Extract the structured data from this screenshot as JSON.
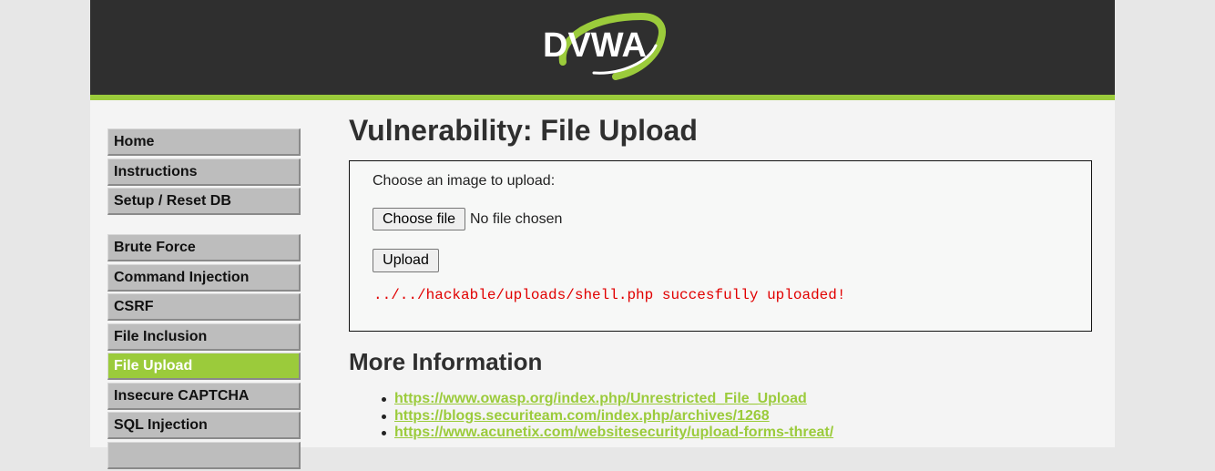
{
  "header": {
    "logo_text": "DVWA"
  },
  "menu": {
    "groups": [
      [
        {
          "label": "Home",
          "selected": false
        },
        {
          "label": "Instructions",
          "selected": false
        },
        {
          "label": "Setup / Reset DB",
          "selected": false
        }
      ],
      [
        {
          "label": "Brute Force",
          "selected": false
        },
        {
          "label": "Command Injection",
          "selected": false
        },
        {
          "label": "CSRF",
          "selected": false
        },
        {
          "label": "File Inclusion",
          "selected": false
        },
        {
          "label": "File Upload",
          "selected": true
        },
        {
          "label": "Insecure CAPTCHA",
          "selected": false
        },
        {
          "label": "SQL Injection",
          "selected": false
        }
      ]
    ]
  },
  "main": {
    "title": "Vulnerability: File Upload",
    "upload_form": {
      "prompt": "Choose an image to upload:",
      "choose_button": "Choose file",
      "file_status": "No file chosen",
      "upload_button": "Upload",
      "result_message": "../../hackable/uploads/shell.php succesfully uploaded!"
    },
    "more_info": {
      "heading": "More Information",
      "links": [
        "https://www.owasp.org/index.php/Unrestricted_File_Upload",
        "https://blogs.securiteam.com/index.php/archives/1268",
        "https://www.acunetix.com/websitesecurity/upload-forms-threat/"
      ]
    }
  },
  "colors": {
    "accent": "#9bcb3b",
    "header_bg": "#2f2f2f",
    "error_text": "#e10000",
    "menu_bg": "#bdbdbd"
  }
}
